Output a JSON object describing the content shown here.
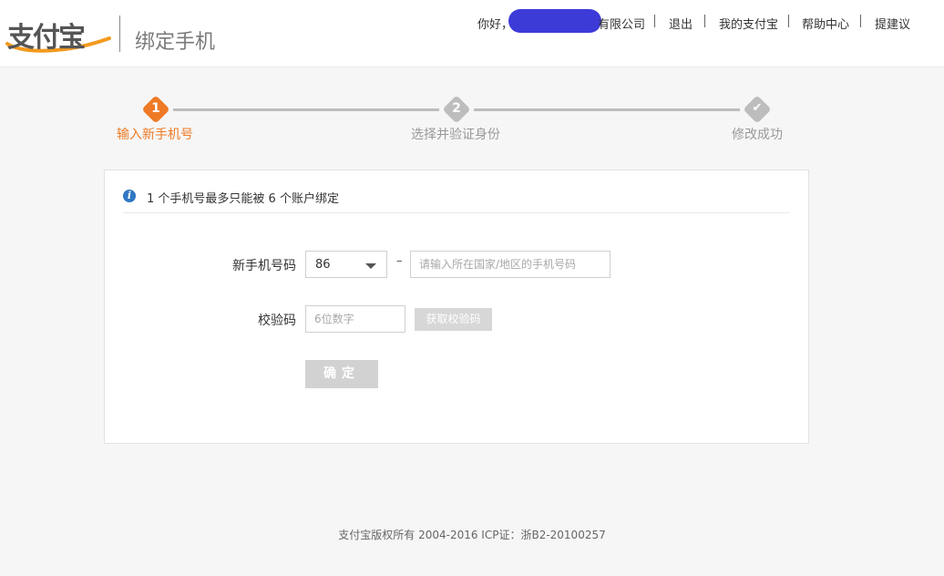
{
  "header": {
    "logo_text": "支付宝",
    "title": "绑定手机",
    "greeting": "你好，",
    "company_suffix": "有限公司",
    "nav": [
      "退出",
      "我的支付宝",
      "帮助中心",
      "提建议"
    ]
  },
  "steps": [
    {
      "num": "1",
      "label": "输入新手机号",
      "state": "active"
    },
    {
      "num": "2",
      "label": "选择并验证身份",
      "state": "pending"
    },
    {
      "num": "✔",
      "label": "修改成功",
      "state": "pending"
    }
  ],
  "colors": {
    "active": "#ee7a25",
    "pending": "#bdbdbd",
    "info": "#2f78c4",
    "redaction": "#3d3bd8"
  },
  "notice": {
    "icon": "info-icon",
    "text": "1 个手机号最多只能被 6 个账户绑定"
  },
  "form": {
    "phone_label": "新手机号码",
    "country_code": "86",
    "dash": "–",
    "phone_placeholder": "请输入所在国家/地区的手机号码",
    "code_label": "校验码",
    "code_placeholder": "6位数字",
    "get_code_label": "获取校验码",
    "confirm_label": "确定"
  },
  "footer": {
    "text": "支付宝版权所有 2004-2016 ICP证：浙B2-20100257"
  }
}
